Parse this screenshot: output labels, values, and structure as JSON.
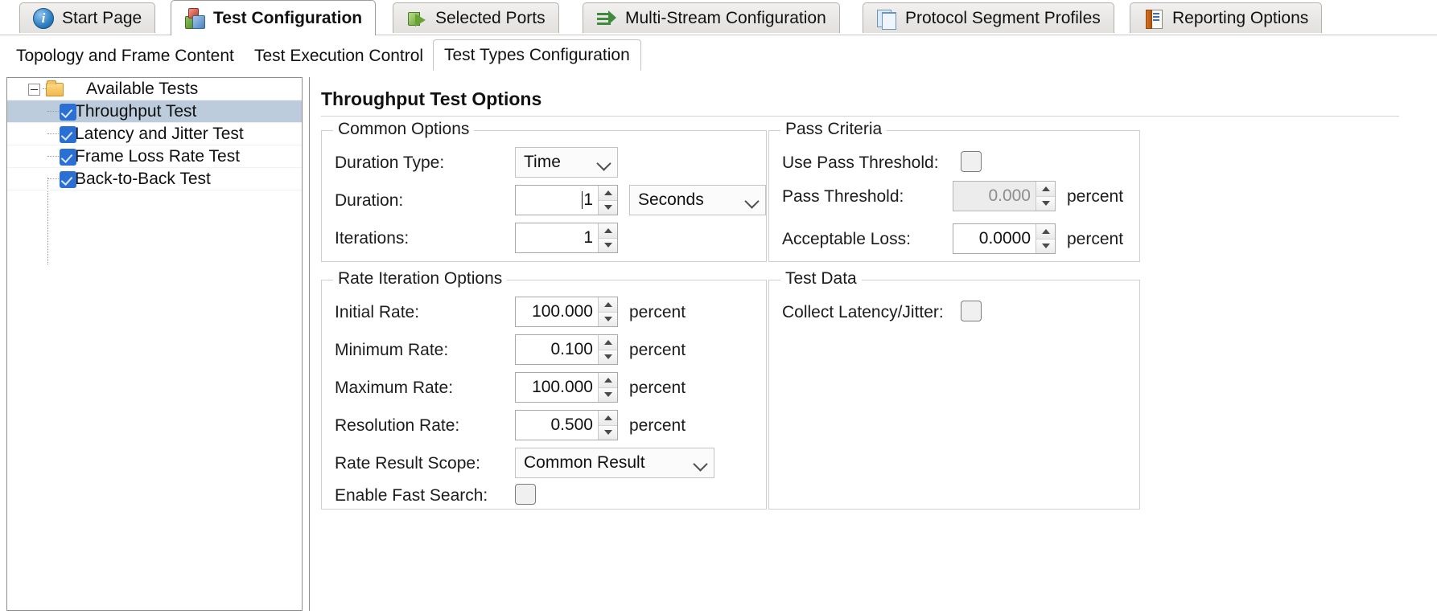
{
  "outer_tabs": [
    {
      "label": "Start Page",
      "icon": "info-icon",
      "active": false
    },
    {
      "label": "Test Configuration",
      "icon": "cubes-icon",
      "active": true
    },
    {
      "label": "Selected Ports",
      "icon": "ports-icon",
      "active": false
    },
    {
      "label": "Multi-Stream Configuration",
      "icon": "stream-icon",
      "active": false
    },
    {
      "label": "Protocol Segment Profiles",
      "icon": "documents-icon",
      "active": false
    },
    {
      "label": "Reporting Options",
      "icon": "report-icon",
      "active": false
    }
  ],
  "inner_tabs": [
    {
      "label": "Topology and Frame Content",
      "active": false
    },
    {
      "label": "Test Execution Control",
      "active": false
    },
    {
      "label": "Test Types Configuration",
      "active": true
    }
  ],
  "tree": {
    "root": {
      "label": "Available Tests",
      "expander": "collapse-minus-icon",
      "icon": "folder-icon"
    },
    "items": [
      {
        "label": "Throughput Test",
        "checked": true,
        "selected": true
      },
      {
        "label": "Latency and Jitter Test",
        "checked": true,
        "selected": false
      },
      {
        "label": "Frame Loss Rate Test",
        "checked": true,
        "selected": false
      },
      {
        "label": "Back-to-Back Test",
        "checked": true,
        "selected": false
      }
    ]
  },
  "content": {
    "title": "Throughput Test Options",
    "common_options": {
      "legend": "Common Options",
      "duration_type": {
        "label": "Duration Type:",
        "value": "Time"
      },
      "duration": {
        "label": "Duration:",
        "value": "1",
        "unit_value": "Seconds"
      },
      "iterations": {
        "label": "Iterations:",
        "value": "1"
      }
    },
    "rate_iteration_options": {
      "legend": "Rate Iteration Options",
      "initial_rate": {
        "label": "Initial Rate:",
        "value": "100.000",
        "unit": "percent"
      },
      "minimum_rate": {
        "label": "Minimum Rate:",
        "value": "0.100",
        "unit": "percent"
      },
      "maximum_rate": {
        "label": "Maximum Rate:",
        "value": "100.000",
        "unit": "percent"
      },
      "resolution_rate": {
        "label": "Resolution Rate:",
        "value": "0.500",
        "unit": "percent"
      },
      "rate_result_scope": {
        "label": "Rate Result Scope:",
        "value": "Common Result"
      },
      "enable_fast_search": {
        "label": "Enable Fast Search:",
        "checked": false
      }
    },
    "pass_criteria": {
      "legend": "Pass Criteria",
      "use_pass_threshold": {
        "label": "Use Pass Threshold:",
        "checked": false
      },
      "pass_threshold": {
        "label": "Pass Threshold:",
        "value": "0.000",
        "unit": "percent",
        "disabled": true
      },
      "acceptable_loss": {
        "label": "Acceptable Loss:",
        "value": "0.0000",
        "unit": "percent",
        "disabled": false
      }
    },
    "test_data": {
      "legend": "Test Data",
      "collect_latency_jitter": {
        "label": "Collect Latency/Jitter:",
        "checked": false
      }
    }
  },
  "colors": {
    "selection": "#bcccdc",
    "checkbox_blue": "#2a6fd4",
    "folder": "#f0b84b",
    "border": "#8d8d8d",
    "group_border": "#cfcfcf",
    "disabled_field": "#ececec"
  }
}
